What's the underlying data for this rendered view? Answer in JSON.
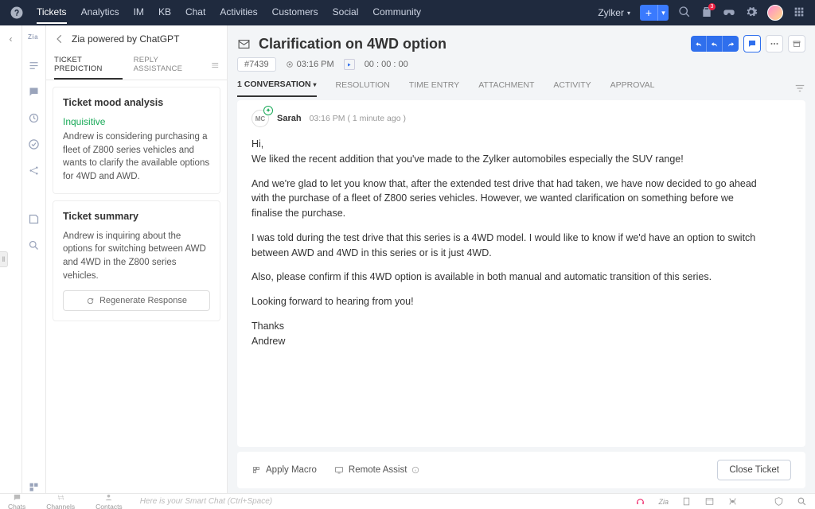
{
  "topnav": {
    "items": [
      "Tickets",
      "Analytics",
      "IM",
      "KB",
      "Chat",
      "Activities",
      "Customers",
      "Social",
      "Community"
    ],
    "activeIndex": 0
  },
  "workspace": "Zylker",
  "zia": {
    "header": "Zia powered by ChatGPT",
    "tabs": {
      "prediction": "TICKET PREDICTION",
      "reply": "REPLY ASSISTANCE"
    },
    "mood": {
      "title": "Ticket mood analysis",
      "label": "Inquisitive",
      "body": "Andrew is considering purchasing a fleet of Z800 series vehicles and wants to clarify the available options for 4WD and AWD."
    },
    "summary": {
      "title": "Ticket summary",
      "body": "Andrew is inquiring about the options for switching between AWD and 4WD in the Z800 series vehicles."
    },
    "regen": "Regenerate Response"
  },
  "ticket": {
    "title": "Clarification on 4WD option",
    "id": "#7439",
    "time": "03:16 PM",
    "timer": "00 : 00 : 00",
    "tabs": {
      "conv": "1 CONVERSATION",
      "resolution": "RESOLUTION",
      "time": "TIME ENTRY",
      "attach": "ATTACHMENT",
      "activity": "ACTIVITY",
      "approval": "APPROVAL"
    }
  },
  "message": {
    "avatar": "MC",
    "sender": "Sarah",
    "timestamp": "03:16 PM ( 1 minute ago )",
    "body": {
      "p0": "Hi,",
      "p1": "We liked the recent addition that you've made to the Zylker automobiles especially the SUV range!",
      "p2": "And we're glad to let you know that, after the extended test drive that had taken, we have now decided to go ahead with the purchase of a fleet of Z800 series vehicles. However, we wanted clarification on something before we finalise the purchase.",
      "p3": "I was told during the test drive that this series is a 4WD model. I would like to know if we'd have an option to switch between AWD and 4WD in this series or is it just 4WD.",
      "p4": "Also, please confirm if this 4WD option is available in both manual and automatic transition of this series.",
      "p5": "Looking forward to hearing from you!",
      "sig1": "Thanks",
      "sig2": "Andrew"
    }
  },
  "footer": {
    "macro": "Apply Macro",
    "remote": "Remote Assist",
    "close": "Close Ticket"
  },
  "bottom": {
    "chats": "Chats",
    "channels": "Channels",
    "contacts": "Contacts",
    "placeholder": "Here is your Smart Chat (Ctrl+Space)",
    "zia": "Zia"
  }
}
